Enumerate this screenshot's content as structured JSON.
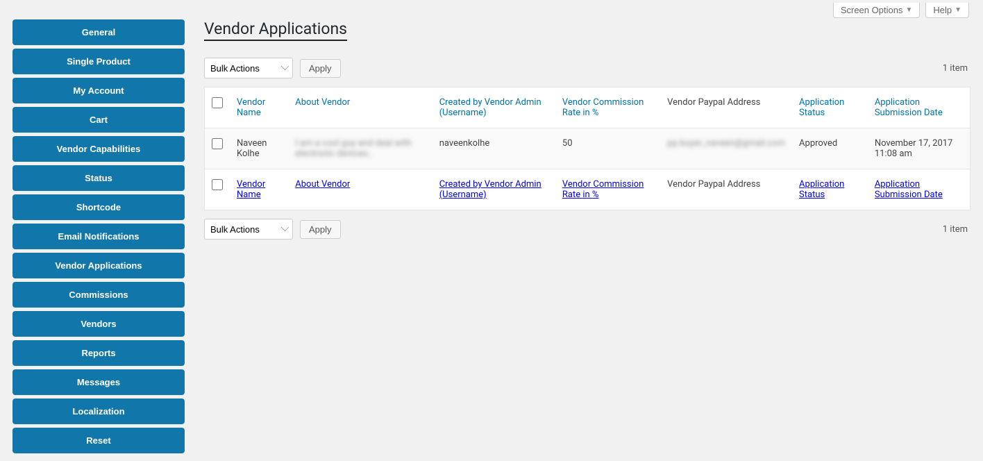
{
  "top_controls": {
    "screen_options": "Screen Options",
    "help": "Help"
  },
  "sidebar": {
    "items": [
      {
        "label": "General"
      },
      {
        "label": "Single Product"
      },
      {
        "label": "My Account"
      },
      {
        "label": "Cart"
      },
      {
        "label": "Vendor Capabilities"
      },
      {
        "label": "Status"
      },
      {
        "label": "Shortcode"
      },
      {
        "label": "Email Notifications"
      },
      {
        "label": "Vendor Applications"
      },
      {
        "label": "Commissions"
      },
      {
        "label": "Vendors"
      },
      {
        "label": "Reports"
      },
      {
        "label": "Messages"
      },
      {
        "label": "Localization"
      },
      {
        "label": "Reset"
      }
    ]
  },
  "page_title": "Vendor Applications",
  "bulk_actions": {
    "selected": "Bulk Actions",
    "apply_label": "Apply"
  },
  "item_count": "1 item",
  "columns": {
    "vendor_name": "Vendor Name",
    "about_vendor": "About Vendor",
    "created_by": "Created by Vendor Admin (Username)",
    "commission": "Vendor Commission Rate in %",
    "paypal": "Vendor Paypal Address",
    "status": "Application Status",
    "submission_date": "Application Submission Date"
  },
  "rows": [
    {
      "vendor_name": "Naveen Kolhe",
      "about_vendor": "I am a cool guy and deal with electronic devices..",
      "created_by": "naveenkolhe",
      "commission": "50",
      "paypal": "pp.buyer_naveen@gmail.com",
      "status": "Approved",
      "submission_date": "November 17, 2017 11:08 am"
    }
  ]
}
